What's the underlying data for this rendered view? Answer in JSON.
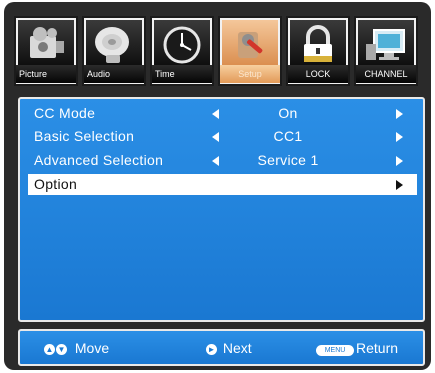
{
  "tabs": [
    {
      "label": "Picture",
      "icon": "camera-icon"
    },
    {
      "label": "Audio",
      "icon": "speaker-icon"
    },
    {
      "label": "Time",
      "icon": "clock-icon"
    },
    {
      "label": "Setup",
      "icon": "tools-icon",
      "active": true
    },
    {
      "label": "LOCK",
      "icon": "padlock-icon"
    },
    {
      "label": "CHANNEL",
      "icon": "monitor-icon"
    }
  ],
  "menu": {
    "items": [
      {
        "name": "CC Mode",
        "value": "On"
      },
      {
        "name": "Basic Selection",
        "value": "CC1"
      },
      {
        "name": "Advanced Selection",
        "value": "Service 1"
      },
      {
        "name": "Option",
        "value": ""
      }
    ]
  },
  "footer": {
    "move_label": "Move",
    "next_label": "Next",
    "menu_key": "MENU",
    "return_label": "Return"
  },
  "colors": {
    "panel_blue": "#1a78d2",
    "selected_row": "#ffffff",
    "active_tab": "#e29a58"
  }
}
